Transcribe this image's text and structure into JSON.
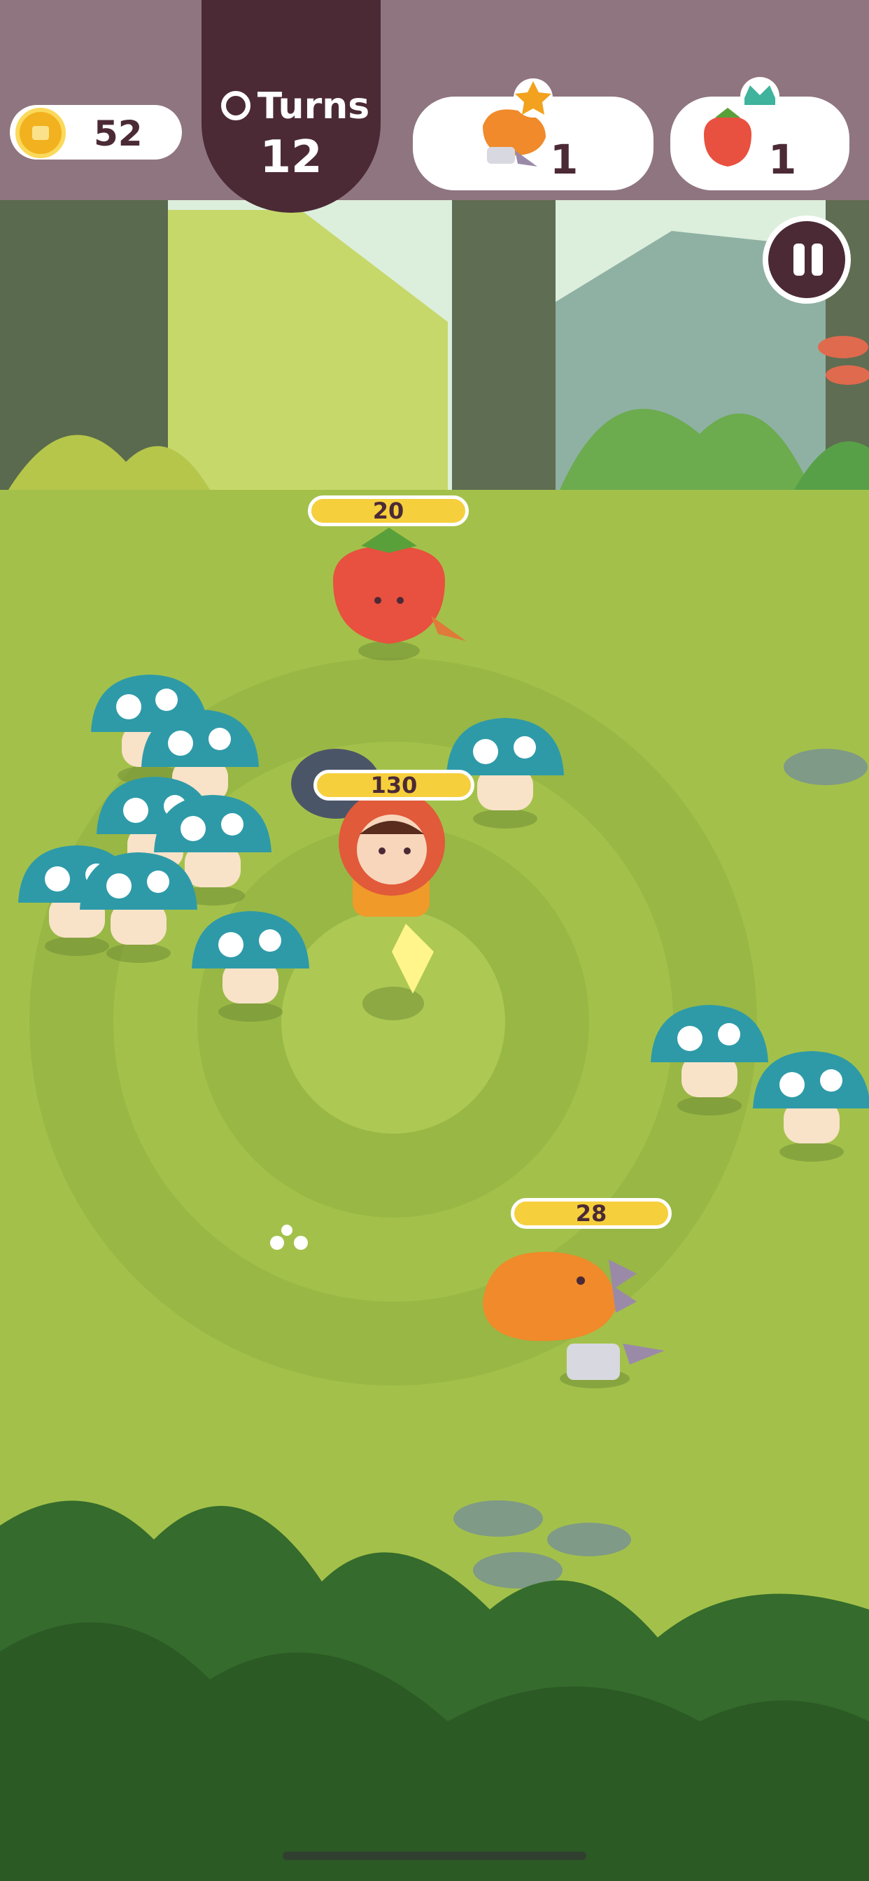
{
  "hud": {
    "coins": "52",
    "turns_label": "Turns",
    "turns_value": "12",
    "targets": [
      {
        "name": "dinosaur",
        "count": "1",
        "badge": "star-icon"
      },
      {
        "name": "strawberry",
        "count": "1",
        "badge": "crown-icon"
      }
    ],
    "pause": "pause-icon"
  },
  "units": {
    "strawberry_hp": "20",
    "hero_hp": "130",
    "dino_hp": "28"
  },
  "colors": {
    "hud_bg": "#8f7580",
    "turns_bg": "#4b2a36",
    "hp_bar": "#f6cf3c",
    "grass": "#a3c14a"
  }
}
